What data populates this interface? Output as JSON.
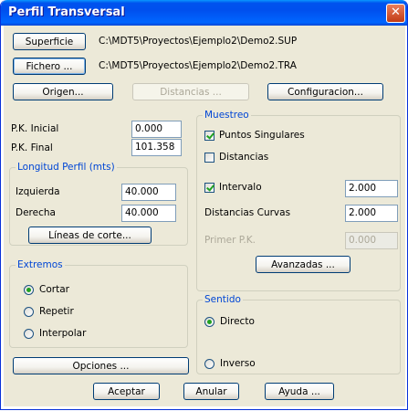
{
  "window": {
    "title": "Perfil Transversal",
    "close_glyph": "✕"
  },
  "top": {
    "superficie_label": "Superficie",
    "superficie_path": "C:\\MDT5\\Proyectos\\Ejemplo2\\Demo2.SUP",
    "fichero_label": "Fichero ...",
    "fichero_path": "C:\\MDT5\\Proyectos\\Ejemplo2\\Demo2.TRA",
    "origen_label": "Origen...",
    "distancias_label": "Distancias ...",
    "configuracion_label": "Configuracion..."
  },
  "pk": {
    "inicial_label": "P.K. Inicial",
    "inicial_value": "0.000",
    "final_label": "P.K. Final",
    "final_value": "101.358"
  },
  "longitud": {
    "title": "Longitud Perfil (mts)",
    "izquierda_label": "Izquierda",
    "izquierda_value": "40.000",
    "derecha_label": "Derecha",
    "derecha_value": "40.000",
    "lineas_label": "Líneas de corte..."
  },
  "extremos": {
    "title": "Extremos",
    "options": [
      {
        "label": "Cortar",
        "checked": true
      },
      {
        "label": "Repetir",
        "checked": false
      },
      {
        "label": "Interpolar",
        "checked": false
      }
    ]
  },
  "opciones_label": "Opciones ...",
  "muestreo": {
    "title": "Muestreo",
    "puntos_label": "Puntos Singulares",
    "puntos_checked": true,
    "distancias_label": "Distancias",
    "distancias_checked": false,
    "intervalo_label": "Intervalo",
    "intervalo_checked": true,
    "intervalo_value": "2.000",
    "curvas_label": "Distancias Curvas",
    "curvas_value": "2.000",
    "primer_label": "Primer P.K.",
    "primer_value": "0.000",
    "avanzadas_label": "Avanzadas ..."
  },
  "sentido": {
    "title": "Sentido",
    "options": [
      {
        "label": "Directo",
        "checked": true
      },
      {
        "label": "Inverso",
        "checked": false
      }
    ]
  },
  "footer": {
    "aceptar_label": "Aceptar",
    "anular_label": "Anular",
    "ayuda_label": "Ayuda ..."
  }
}
